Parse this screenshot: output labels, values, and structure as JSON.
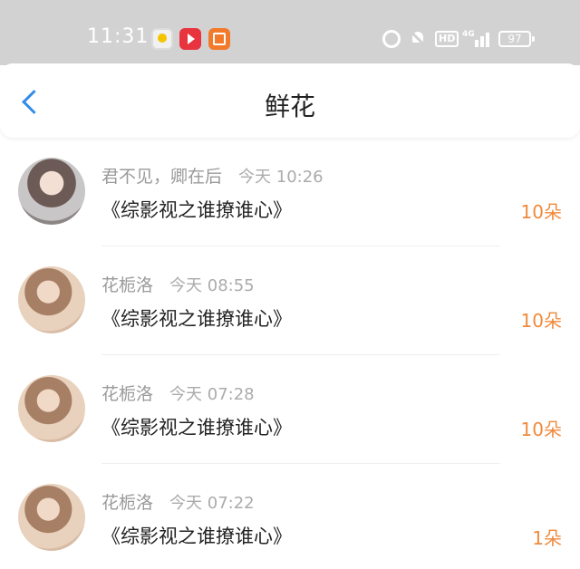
{
  "status_bar": {
    "time": "11:31",
    "network_label": "4G",
    "hd_label": "HD",
    "battery": "97"
  },
  "header": {
    "title": "鲜花"
  },
  "gifts": [
    {
      "user": "君不见，卿在后",
      "time": "今天 10:26",
      "book": "《综影视之谁撩谁心》",
      "count": "10朵",
      "avatar": "avatar-girl-long-hair"
    },
    {
      "user": "花栀洛",
      "time": "今天 08:55",
      "book": "《综影视之谁撩谁心》",
      "count": "10朵",
      "avatar": "avatar-girl-wavy-hair"
    },
    {
      "user": "花栀洛",
      "time": "今天 07:28",
      "book": "《综影视之谁撩谁心》",
      "count": "10朵",
      "avatar": "avatar-girl-wavy-hair"
    },
    {
      "user": "花栀洛",
      "time": "今天 07:22",
      "book": "《综影视之谁撩谁心》",
      "count": "1朵",
      "avatar": "avatar-girl-wavy-hair"
    }
  ],
  "colors": {
    "status_bar_bg": "#d2d2d2",
    "accent_blue": "#2f8ce6",
    "count_orange": "#f08a3c"
  }
}
